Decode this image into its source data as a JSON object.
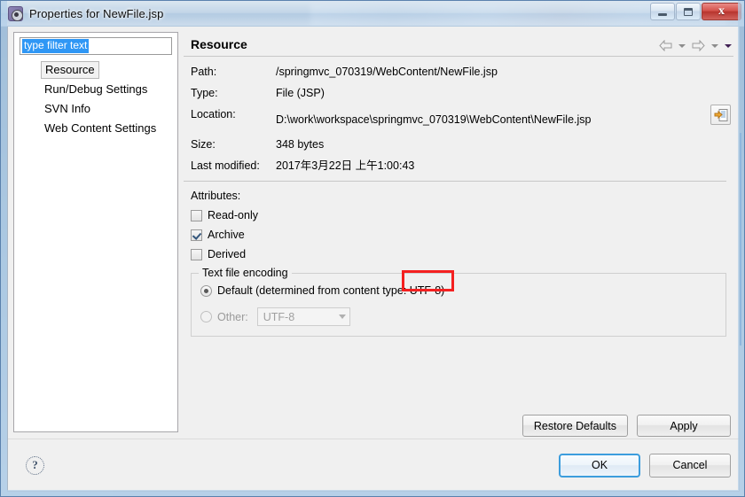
{
  "window": {
    "title": "Properties for NewFile.jsp",
    "icon": "properties-gear-icon",
    "minimize_label": "",
    "maximize_label": "",
    "close_label": "x"
  },
  "sidebar": {
    "filter": {
      "value": "type filter text",
      "placeholder": "type filter text"
    },
    "items": [
      {
        "label": "Resource",
        "selected": true
      },
      {
        "label": "Run/Debug Settings",
        "selected": false
      },
      {
        "label": "SVN Info",
        "selected": false
      },
      {
        "label": "Web Content Settings",
        "selected": false
      }
    ]
  },
  "content": {
    "title": "Resource",
    "properties": [
      {
        "label": "Path:",
        "value": "/springmvc_070319/WebContent/NewFile.jsp"
      },
      {
        "label": "Type:",
        "value": "File  (JSP)"
      },
      {
        "label": "Location:",
        "value": "D:\\work\\workspace\\springmvc_070319\\WebContent\\NewFile.jsp"
      },
      {
        "label": "Size:",
        "value": "348  bytes"
      },
      {
        "label": "Last modified:",
        "value": "2017年3月22日 上午1:00:43"
      }
    ],
    "attributes": {
      "title": "Attributes:",
      "items": [
        {
          "label": "Read-only",
          "checked": false
        },
        {
          "label": "Archive",
          "checked": true
        },
        {
          "label": "Derived",
          "checked": false
        }
      ]
    },
    "encoding": {
      "legend": "Text file encoding",
      "default_option": "Default (determined from content type: UTF-8)",
      "default_selected": true,
      "other_option": "Other:",
      "other_selected": false,
      "other_value": "UTF-8"
    },
    "annotation": {
      "type": "red-rectangle",
      "color": "#f42020",
      "targets": "UTF-8)"
    },
    "buttons": {
      "restore_defaults": "Restore Defaults",
      "apply": "Apply"
    },
    "nav": {
      "back_icon": "arrow-left-icon",
      "back_menu_icon": "chevron-down-icon",
      "forward_icon": "arrow-right-icon",
      "forward_menu_icon": "chevron-down-icon",
      "menu_icon": "chevron-down-filled-icon"
    },
    "location_button_icon": "open-external-file-icon"
  },
  "footer": {
    "help_icon": "?",
    "ok": "OK",
    "cancel": "Cancel"
  }
}
